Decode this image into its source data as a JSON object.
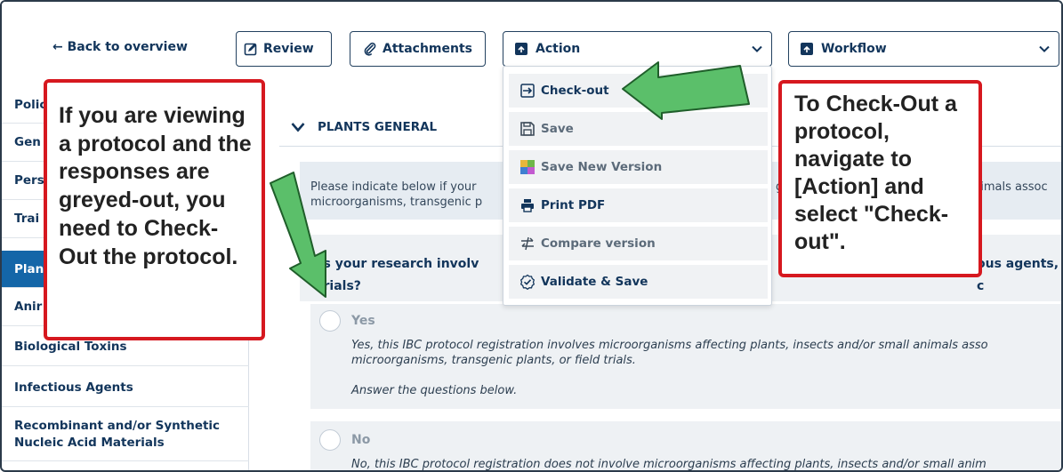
{
  "toolbar": {
    "back_label": "Back to overview",
    "review_label": "Review",
    "attachments_label": "Attachments",
    "action_label": "Action",
    "workflow_label": "Workflow"
  },
  "action_menu": {
    "items": [
      {
        "label": "Check-out",
        "icon": "check-out-icon"
      },
      {
        "label": "Save",
        "icon": "save-icon"
      },
      {
        "label": "Save New Version",
        "icon": "save-new-version-icon"
      },
      {
        "label": "Print PDF",
        "icon": "printer-icon"
      },
      {
        "label": "Compare version",
        "icon": "compare-icon"
      },
      {
        "label": "Validate & Save",
        "icon": "validate-icon"
      }
    ]
  },
  "sidebar": {
    "items": [
      {
        "label": "Polic"
      },
      {
        "label": "Gen"
      },
      {
        "label": "Pers"
      },
      {
        "label": "Trai"
      },
      {
        "label": "Plan",
        "active": true
      },
      {
        "label": "Anir"
      },
      {
        "label": "Biological Toxins"
      },
      {
        "label": "Infectious Agents"
      },
      {
        "label": "Recombinant and/or Synthetic Nucleic Acid Materials"
      }
    ]
  },
  "section": {
    "title": "PLANTS GENERAL",
    "info_line1": "Please indicate below if your",
    "info_line1_right": "g",
    "info_line1_far": "nimals assoc",
    "info_line2": "microorganisms, transgenic p",
    "question_line1_a": "es your research involv",
    "question_line1_b": "u",
    "question_line1_c": "ous agents, c",
    "question_line2": "erials?"
  },
  "options": [
    {
      "label": "Yes",
      "desc_line1": "Yes, this IBC protocol registration involves microorganisms affecting plants, insects and/or small animals asso",
      "desc_line2": "microorganisms, transgenic plants, or field trials.",
      "desc_line3": "Answer the questions below."
    },
    {
      "label": "No",
      "desc_line1": "No, this IBC protocol registration does not involve microorganisms affecting plants, insects and/or small anim"
    }
  ],
  "callouts": {
    "left": "If you are viewing a protocol and the responses are greyed-out, you need to Check-Out the protocol.",
    "right": "To Check-Out a protocol, navigate to [Action] and select \"Check-out\"."
  },
  "colors": {
    "callout_border": "#d6181f",
    "arrow_fill": "#5bbf6a",
    "nav_active": "#1466a8",
    "brand_text": "#12355b"
  }
}
